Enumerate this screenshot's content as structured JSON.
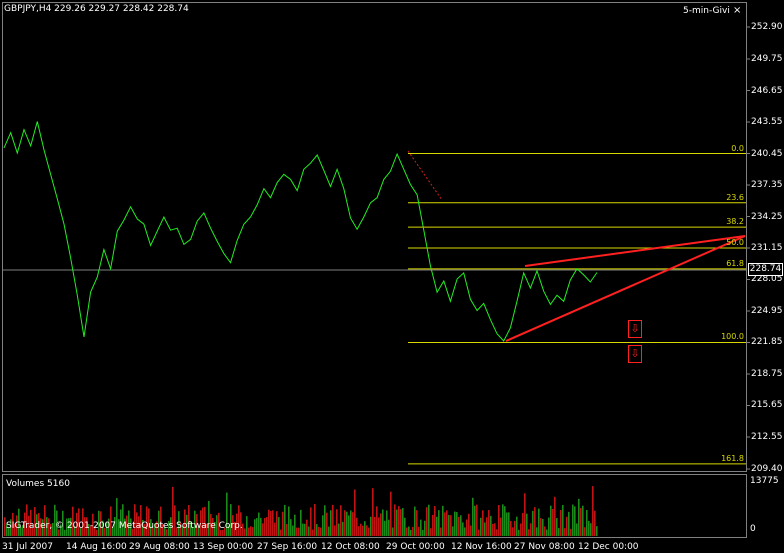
{
  "header": {
    "title": "GBPJPY,H4  229.26 229.27 228.42 228.74",
    "indicator": "5-min-Givi",
    "close_glyph": "×"
  },
  "price_axis": {
    "labels": [
      "252.90",
      "249.75",
      "246.65",
      "243.55",
      "240.45",
      "237.35",
      "234.25",
      "231.15",
      "228.05",
      "224.95",
      "221.85",
      "218.75",
      "215.65",
      "212.55",
      "209.40"
    ],
    "current_price": "228.74"
  },
  "fibonacci": {
    "levels": [
      "0.0",
      "23.6",
      "38.2",
      "50.0",
      "61.8",
      "100.0",
      "161.8"
    ],
    "level_prices": [
      240.45,
      235.6,
      233.2,
      231.15,
      229.1,
      221.85,
      209.9
    ]
  },
  "volume_panel": {
    "label": "Volumes 5160",
    "axis_max": "13775",
    "axis_min": "0",
    "copyright": "SIGTrader, © 2001-2007 MetaQuotes Software Corp."
  },
  "time_axis": {
    "labels": [
      "31 Jul 2007",
      "14 Aug 16:00",
      "29 Aug 08:00",
      "13 Sep 00:00",
      "27 Sep 16:00",
      "12 Oct 08:00",
      "29 Oct 00:00",
      "12 Nov 16:00",
      "27 Nov 08:00",
      "12 Dec 00:00"
    ]
  },
  "colors": {
    "price_line": "#22ee22",
    "fib_line": "#d8d800",
    "trend_line": "#ff2020",
    "volume_up": "#1a8a1a",
    "volume_down": "#c01414"
  },
  "signals": [
    "down-arrow",
    "down-arrow"
  ],
  "chart_data": {
    "type": "line",
    "series": [
      {
        "values": [
          241.0,
          242.5,
          240.5,
          242.8,
          241.2,
          243.6,
          240.8,
          238.4,
          236.0,
          233.5,
          230.2,
          226.5,
          222.4,
          226.8,
          228.3,
          231.0,
          229.1,
          232.8,
          233.9,
          235.2,
          234.0,
          233.5,
          231.4,
          232.8,
          234.2,
          232.9,
          233.1,
          231.5,
          232.0,
          233.8,
          234.6,
          233.1,
          231.8,
          230.6,
          229.7,
          231.9,
          233.5,
          234.2,
          235.4,
          237.0,
          236.1,
          237.6,
          238.4,
          237.9,
          236.8,
          238.9,
          239.5,
          240.3,
          238.8,
          237.2,
          238.9,
          237.0,
          234.1,
          233.0,
          234.2,
          235.6,
          236.1,
          237.9,
          238.7,
          240.4,
          238.9,
          237.4,
          236.4,
          232.9,
          229.4,
          226.8,
          227.9,
          225.9,
          228.1,
          228.7,
          226.1,
          225.0,
          225.7,
          224.1,
          222.7,
          222.0,
          223.3,
          225.9,
          228.7,
          227.2,
          228.9,
          226.9,
          225.6,
          226.5,
          225.9,
          228.0,
          229.1,
          228.5,
          227.8,
          228.74
        ],
        "ylim": [
          209.4,
          252.9
        ]
      }
    ]
  }
}
